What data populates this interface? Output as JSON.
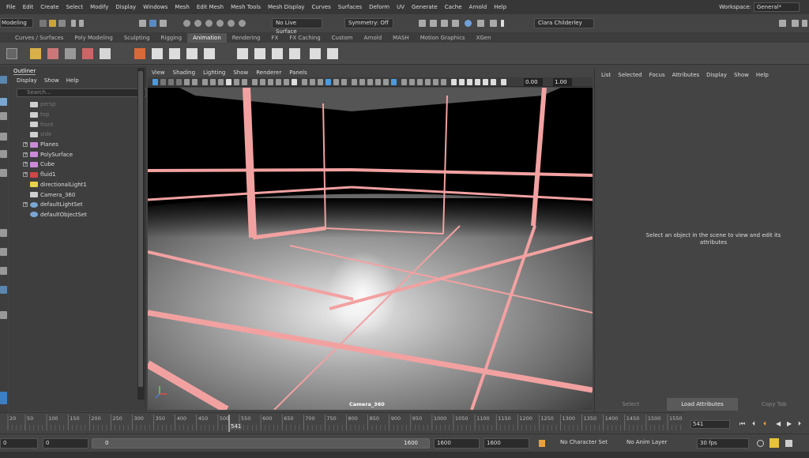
{
  "menubar": {
    "items": [
      "File",
      "Edit",
      "Create",
      "Select",
      "Modify",
      "Display",
      "Windows",
      "Mesh",
      "Edit Mesh",
      "Mesh Tools",
      "Mesh Display",
      "Curves",
      "Surfaces",
      "Deform",
      "UV",
      "Generate",
      "Cache",
      "Arnold",
      "Help"
    ],
    "workspace_label": "Workspace:",
    "workspace_value": "General*"
  },
  "statusline": {
    "mode": "Modeling",
    "live_surface": "No Live Surface",
    "symmetry": "Symmetry: Off",
    "user": "Clara Childerley"
  },
  "shelf": {
    "tabs": [
      "Curves / Surfaces",
      "Poly Modeling",
      "Sculpting",
      "Rigging",
      "Animation",
      "Rendering",
      "FX",
      "FX Caching",
      "Custom",
      "Arnold",
      "MASH",
      "Motion Graphics",
      "XGen"
    ],
    "active_tab": "Animation"
  },
  "outliner": {
    "title": "Outliner",
    "menu": [
      "Display",
      "Show",
      "Help"
    ],
    "search_placeholder": "Search...",
    "items": [
      {
        "label": "persp",
        "type": "camera",
        "dim": true,
        "expandable": false
      },
      {
        "label": "top",
        "type": "camera",
        "dim": true,
        "expandable": false
      },
      {
        "label": "front",
        "type": "camera",
        "dim": true,
        "expandable": false
      },
      {
        "label": "side",
        "type": "camera",
        "dim": true,
        "expandable": false
      },
      {
        "label": "Planes",
        "type": "mesh",
        "dim": false,
        "expandable": true
      },
      {
        "label": "PolySurface",
        "type": "mesh",
        "dim": false,
        "expandable": true
      },
      {
        "label": "Cube",
        "type": "mesh",
        "dim": false,
        "expandable": true
      },
      {
        "label": "fluid1",
        "type": "fluid",
        "dim": false,
        "expandable": true
      },
      {
        "label": "directionalLight1",
        "type": "light",
        "dim": false,
        "expandable": false
      },
      {
        "label": "Camera_360",
        "type": "camera",
        "dim": false,
        "expandable": false
      },
      {
        "label": "defaultLightSet",
        "type": "set",
        "dim": false,
        "expandable": true
      },
      {
        "label": "defaultObjectSet",
        "type": "set",
        "dim": false,
        "expandable": false
      }
    ]
  },
  "viewport": {
    "menu": [
      "View",
      "Shading",
      "Lighting",
      "Show",
      "Renderer",
      "Panels"
    ],
    "exposure": "0.00",
    "gamma": "1.00",
    "camera_label": "Camera_360"
  },
  "attribute_editor": {
    "menu": [
      "List",
      "Selected",
      "Focus",
      "Attributes",
      "Display",
      "Show",
      "Help"
    ],
    "hint": "Select an object in the scene to view and edit its attributes",
    "buttons": [
      "Select",
      "Load Attributes",
      "Copy Tab"
    ]
  },
  "timeslider": {
    "ticks": [
      "20",
      "50",
      "100",
      "150",
      "200",
      "250",
      "300",
      "350",
      "400",
      "450",
      "500",
      "550",
      "600",
      "650",
      "700",
      "750",
      "800",
      "850",
      "900",
      "950",
      "1000",
      "1050",
      "1100",
      "1150",
      "1200",
      "1250",
      "1300",
      "1350",
      "1400",
      "1450",
      "1500",
      "1550"
    ],
    "current_frame": "541",
    "current_field": "541"
  },
  "range": {
    "start": "0",
    "anim_start": "0",
    "range_left": "0",
    "range_right": "1600",
    "anim_end": "1600",
    "end": "1600",
    "character_set": "No Character Set",
    "anim_layer": "No Anim Layer",
    "fps": "30 fps"
  }
}
